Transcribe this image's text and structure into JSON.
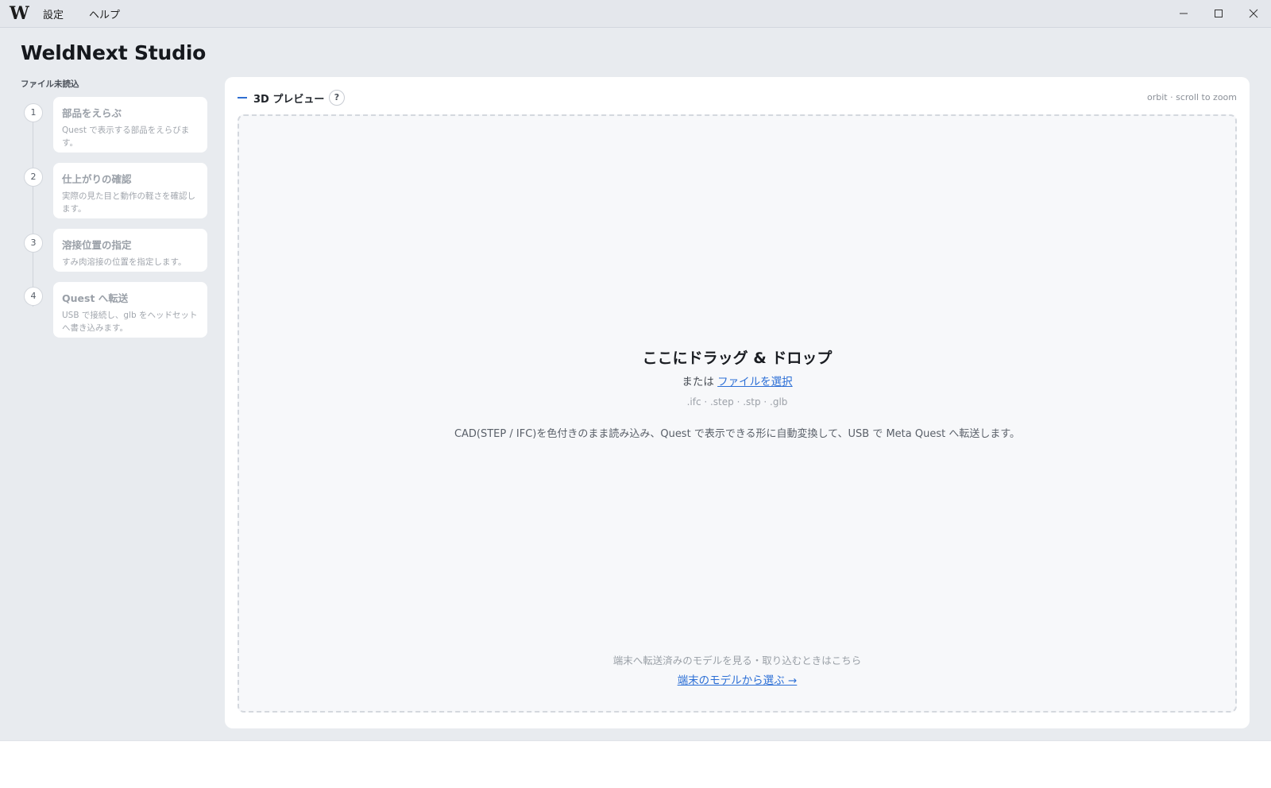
{
  "titlebar": {
    "logo": "W",
    "menu": [
      "設定",
      "ヘルプ"
    ],
    "window_controls": [
      "minimize-icon",
      "maximize-icon",
      "close-icon"
    ]
  },
  "app": {
    "title": "WeldNext Studio",
    "file_status": "ファイル未読込"
  },
  "steps": [
    {
      "number": "1",
      "title": "部品をえらぶ",
      "desc": "Quest で表示する部品をえらびます。"
    },
    {
      "number": "2",
      "title": "仕上がりの確認",
      "desc": "実際の見た目と動作の軽さを確認します。"
    },
    {
      "number": "3",
      "title": "溶接位置の指定",
      "desc": "すみ肉溶接の位置を指定します。"
    },
    {
      "number": "4",
      "title": "Quest へ転送",
      "desc": "USB で接続し、glb をヘッドセットへ書き込みます。"
    }
  ],
  "preview": {
    "label": "3D プレビュー",
    "help": "?",
    "hint": "orbit · scroll to zoom"
  },
  "dropzone": {
    "title": "ここにドラッグ & ドロップ",
    "or_prefix": "または",
    "select_link": "ファイルを選択",
    "extensions": ".ifc · .step · .stp · .glb",
    "description": "CAD(STEP / IFC)を色付きのまま読み込み、Quest で表示できる形に自動変換して、USB で Meta Quest へ転送します。",
    "device_note": "端末へ転送済みのモデルを見る・取り込むときはこちら",
    "device_link": "端末のモデルから選ぶ →"
  },
  "colors": {
    "background": "#e8ebef",
    "card": "#ffffff",
    "accent": "#2c6fd6",
    "muted_text": "#9aa0a8"
  }
}
